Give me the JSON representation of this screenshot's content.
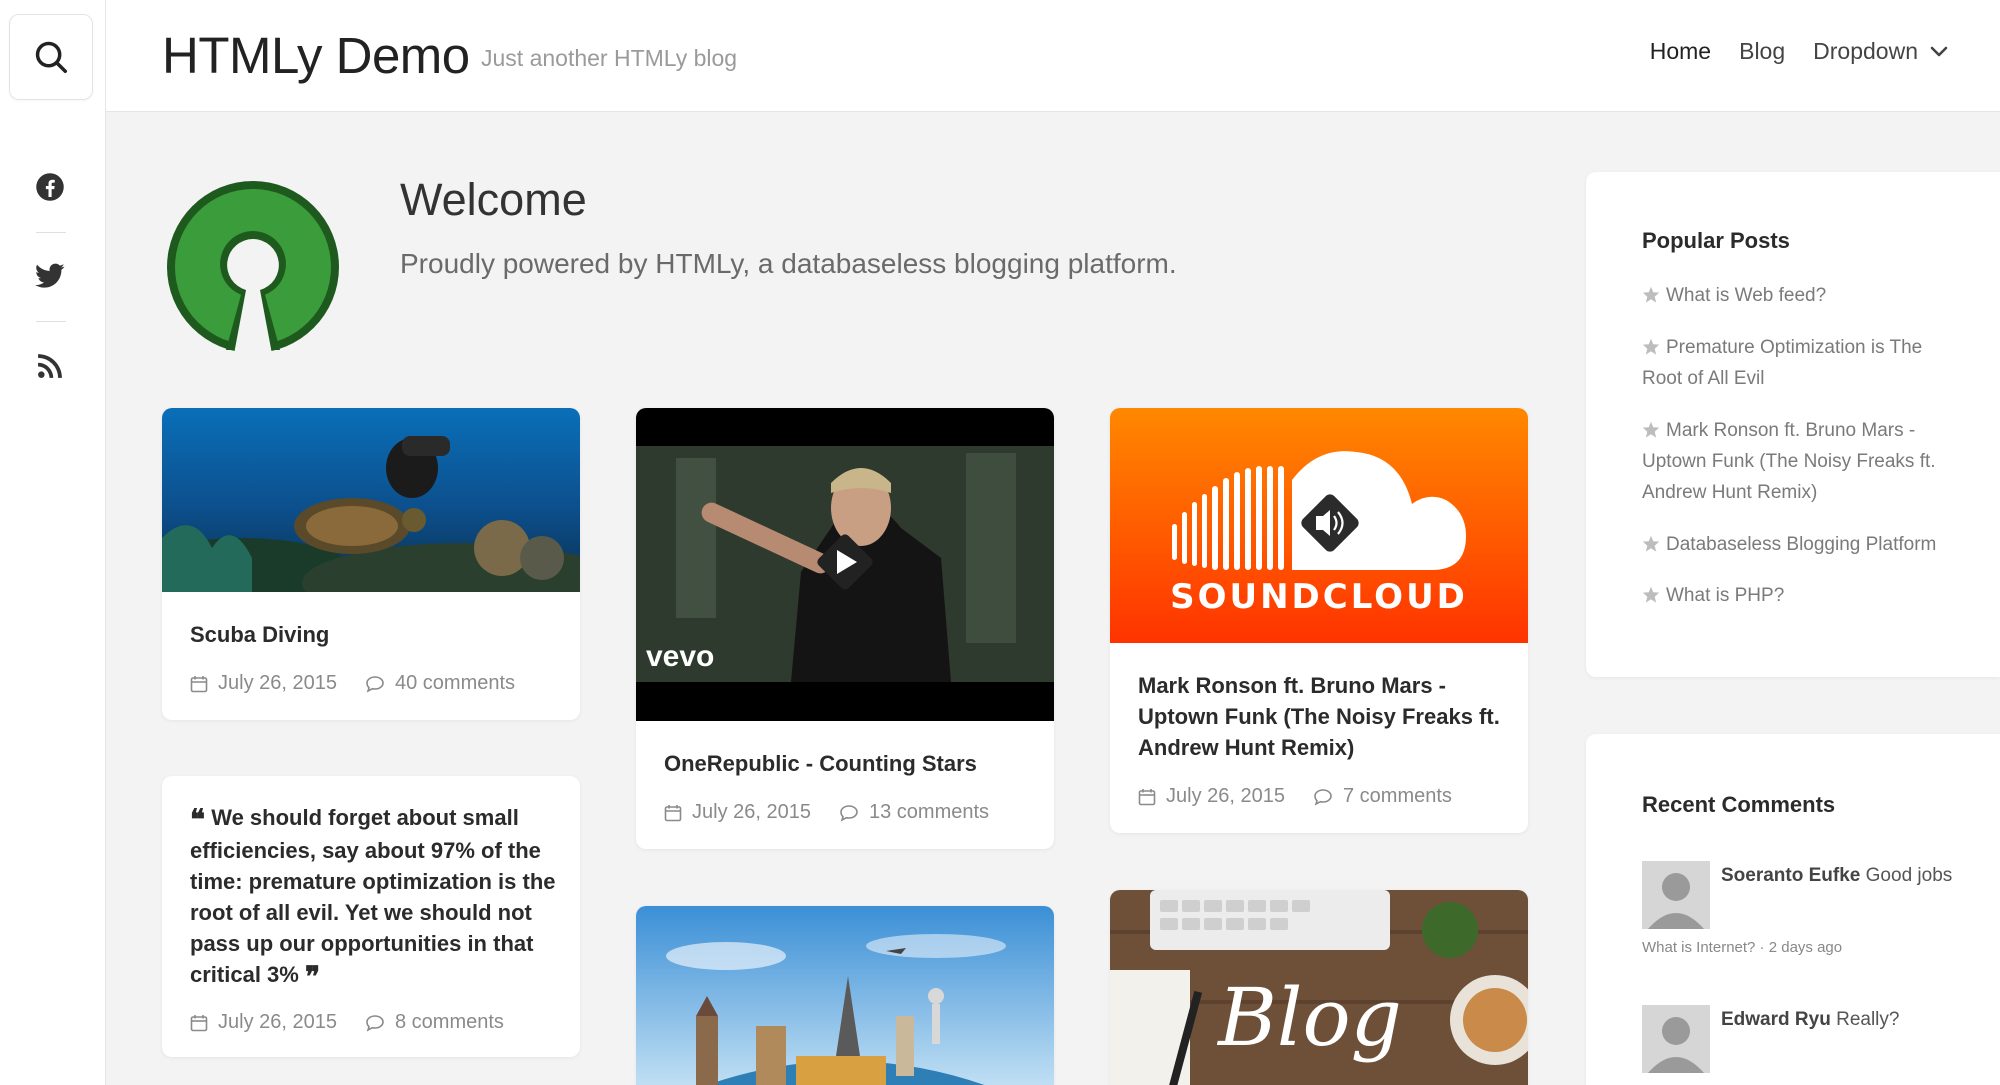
{
  "site": {
    "title": "HTMLy Demo",
    "tagline": "Just another HTMLy blog"
  },
  "nav": {
    "items": [
      {
        "label": "Home",
        "active": true
      },
      {
        "label": "Blog"
      },
      {
        "label": "Dropdown",
        "has_caret": true
      }
    ]
  },
  "rail": {
    "icons": [
      "search-icon",
      "facebook-icon",
      "twitter-icon",
      "rss-icon"
    ]
  },
  "welcome": {
    "title": "Welcome",
    "subtitle": "Proudly powered by HTMLy, a databaseless blogging platform."
  },
  "posts": [
    {
      "title": "Scuba Diving",
      "date": "July 26, 2015",
      "comments": "40 comments",
      "thumb": "scuba-photo"
    },
    {
      "title": "OneRepublic - Counting Stars",
      "date": "July 26, 2015",
      "comments": "13 comments",
      "thumb": "video-thumbnail",
      "overlay_text": "vevo"
    },
    {
      "title": "Mark Ronson ft. Bruno Mars - Uptown Funk (The Noisy Freaks ft. Andrew Hunt Remix)",
      "date": "July 26, 2015",
      "comments": "7 comments",
      "thumb": "soundcloud-logo",
      "overlay_text": "SOUNDCLOUD"
    },
    {
      "quote": "We should forget about small efficiencies, say about 97% of the time: premature optimization is the root of all evil. Yet we should not pass up our opportunities in that critical 3%",
      "date": "July 26, 2015",
      "comments": "8 comments"
    },
    {
      "thumb": "travel-landmarks-photo"
    },
    {
      "thumb": "blog-desk-photo",
      "overlay_text": "Blog"
    }
  ],
  "sidebar": {
    "popular": {
      "title": "Popular Posts",
      "items": [
        "What is Web feed?",
        "Premature Optimization is The Root of All Evil",
        "Mark Ronson ft. Bruno Mars - Uptown Funk (The Noisy Freaks ft. Andrew Hunt Remix)",
        "Databaseless Blogging Platform",
        "What is PHP?"
      ]
    },
    "recent_comments": {
      "title": "Recent Comments",
      "items": [
        {
          "author": "Soeranto Eufke",
          "text": "Good jobs",
          "sub": "What is Internet? · 2 days ago"
        },
        {
          "author": "Edward Ryu",
          "text": "Really?",
          "sub": ""
        }
      ]
    }
  },
  "colors": {
    "logo_green": "#3a9c3a",
    "logo_dark_green": "#1e5a1e",
    "soundcloud_orange": "#ff5500",
    "background": "#f3f3f3"
  }
}
